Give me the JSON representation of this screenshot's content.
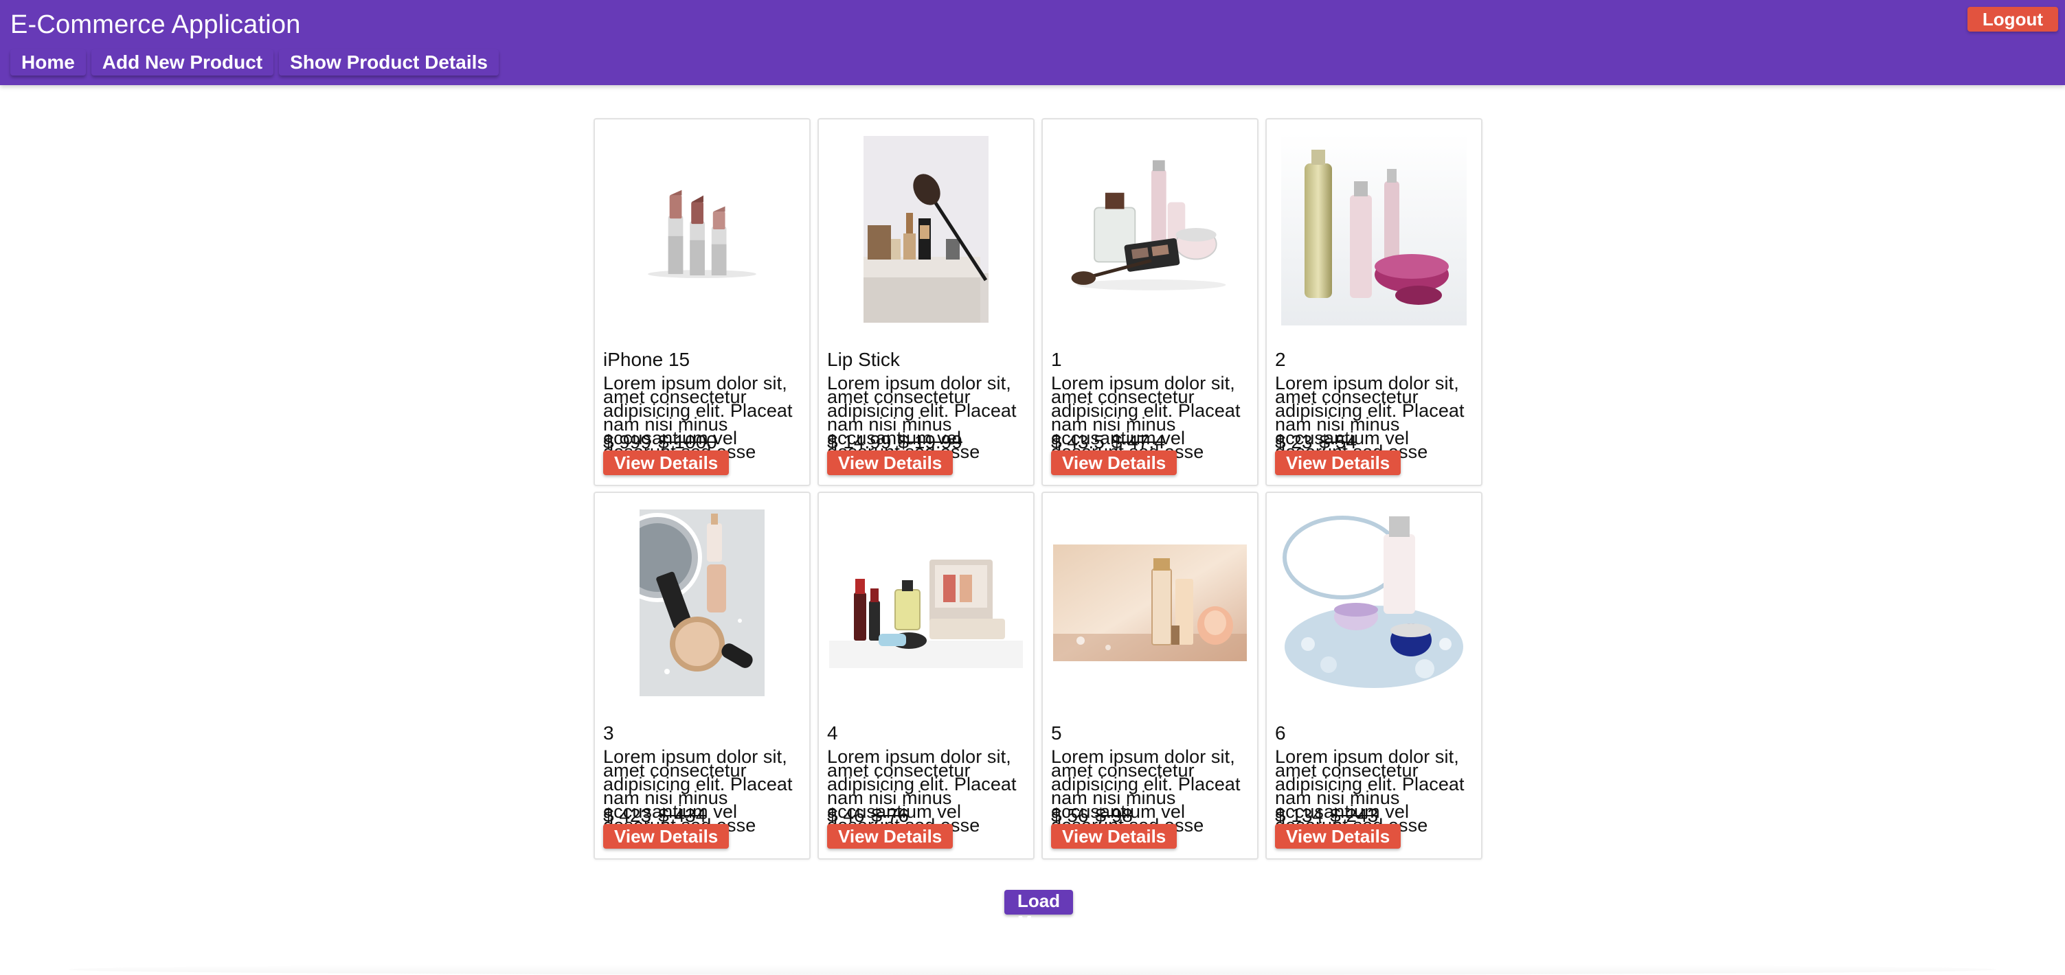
{
  "header": {
    "title": "E-Commerce Application",
    "logout_label": "Logout",
    "accent_color": "#673ab7",
    "danger_color": "#e2533f"
  },
  "nav": {
    "items": [
      {
        "label": "Home"
      },
      {
        "label": "Add New Product"
      },
      {
        "label": "Show Product Details"
      }
    ]
  },
  "products": [
    {
      "name": "iPhone 15",
      "description": "Lorem ipsum dolor sit, amet consectetur adipisicing elit. Placeat nam nisi minus accusantium vel deserunt sed esse rerum",
      "price": "$ 999",
      "old_price": "$ 1000",
      "button": "View Details",
      "image": "lipsticks-image"
    },
    {
      "name": "Lip Stick",
      "description": "Lorem ipsum dolor sit, amet consectetur adipisicing elit. Placeat nam nisi minus accusantium vel deserunt sed esse rerum",
      "price": "$ 14.99",
      "old_price": "$ 19.99",
      "button": "View Details",
      "image": "makeup-brush-image"
    },
    {
      "name": "1",
      "description": "Lorem ipsum dolor sit, amet consectetur adipisicing elit. Placeat nam nisi minus accusantium vel deserunt sed esse rerum",
      "price": "$ 43.5",
      "old_price": "$ 47.4",
      "button": "View Details",
      "image": "cosmetics-set-image"
    },
    {
      "name": "2",
      "description": "Lorem ipsum dolor sit, amet consectetur adipisicing elit. Placeat nam nisi minus accusantium vel deserunt sed esse rerum",
      "price": "$ 23",
      "old_price": "$ 54",
      "button": "View Details",
      "image": "skincare-bottles-image"
    },
    {
      "name": "3",
      "description": "Lorem ipsum dolor sit, amet consectetur adipisicing elit. Placeat nam nisi minus accusantium vel deserunt sed esse rerum",
      "price": "$ 423",
      "old_price": "$ 434",
      "button": "View Details",
      "image": "compact-powder-image"
    },
    {
      "name": "4",
      "description": "Lorem ipsum dolor sit, amet consectetur adipisicing elit. Placeat nam nisi minus accusantium vel deserunt sed esse rerum",
      "price": "$ 46",
      "old_price": "$ 76",
      "button": "View Details",
      "image": "makeup-kit-image"
    },
    {
      "name": "5",
      "description": "Lorem ipsum dolor sit, amet consectetur adipisicing elit. Placeat nam nisi minus accusantium vel deserunt sed esse rerum",
      "price": "$ 56",
      "old_price": "$ 98",
      "button": "View Details",
      "image": "foundation-banner-image"
    },
    {
      "name": "6",
      "description": "Lorem ipsum dolor sit, amet consectetur adipisicing elit. Placeat nam nisi minus accusantium vel deserunt sed esse rerum",
      "price": "$ 134",
      "old_price": "$ 243",
      "button": "View Details",
      "image": "cream-jars-crystals-image"
    }
  ],
  "load_more_label": "Load More"
}
